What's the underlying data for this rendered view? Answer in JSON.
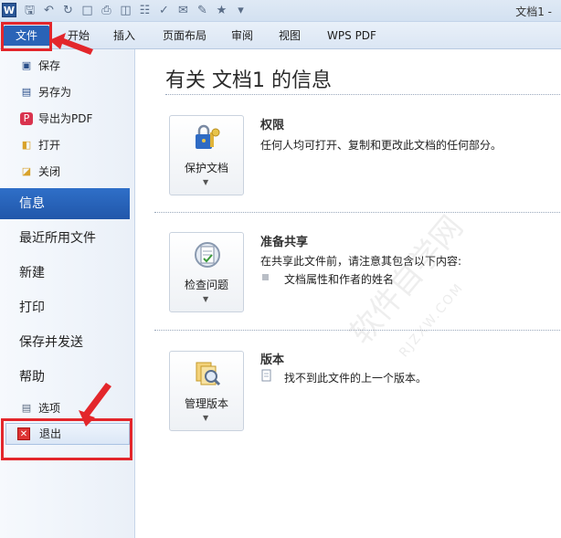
{
  "app": {
    "icon_letter": "W",
    "window_title": "文档1 -"
  },
  "quick_access": [
    "save-icon",
    "undo-icon",
    "redo-icon",
    "new-icon",
    "print-icon",
    "open-icon",
    "print-preview-icon",
    "spellcheck-icon",
    "mail-icon",
    "edit-icon",
    "structure-icon",
    "customize-icon"
  ],
  "ribbon_tabs": [
    {
      "label": "文件"
    },
    {
      "label": "开始"
    },
    {
      "label": "插入"
    },
    {
      "label": "页面布局"
    },
    {
      "label": "审阅"
    },
    {
      "label": "视图"
    },
    {
      "label": "WPS PDF"
    }
  ],
  "sidebar": {
    "quick_items": [
      {
        "label": "保存",
        "icon": "save-icon"
      },
      {
        "label": "另存为",
        "icon": "save-as-icon"
      },
      {
        "label": "导出为PDF",
        "icon": "pdf-icon"
      },
      {
        "label": "打开",
        "icon": "open-folder-icon"
      },
      {
        "label": "关闭",
        "icon": "close-folder-icon"
      }
    ],
    "sections": [
      {
        "label": "信息",
        "active": true
      },
      {
        "label": "最近所用文件"
      },
      {
        "label": "新建"
      },
      {
        "label": "打印"
      },
      {
        "label": "保存并发送"
      },
      {
        "label": "帮助"
      }
    ],
    "options_label": "选项",
    "exit_label": "退出"
  },
  "main": {
    "title": "有关 文档1 的信息",
    "permissions": {
      "button_label": "保护文档",
      "heading": "权限",
      "text": "任何人均可打开、复制和更改此文档的任何部分。"
    },
    "prepare": {
      "button_label": "检查问题",
      "heading": "准备共享",
      "text": "在共享此文件前，请注意其包含以下内容:",
      "bullet": "文档属性和作者的姓名"
    },
    "versions": {
      "button_label": "管理版本",
      "heading": "版本",
      "text": "找不到此文件的上一个版本。"
    }
  },
  "watermark": {
    "text": "软件自学网",
    "url": "RJZXW.COM"
  },
  "colors": {
    "accent": "#2a63b7",
    "annotation_red": "#e3262b"
  }
}
